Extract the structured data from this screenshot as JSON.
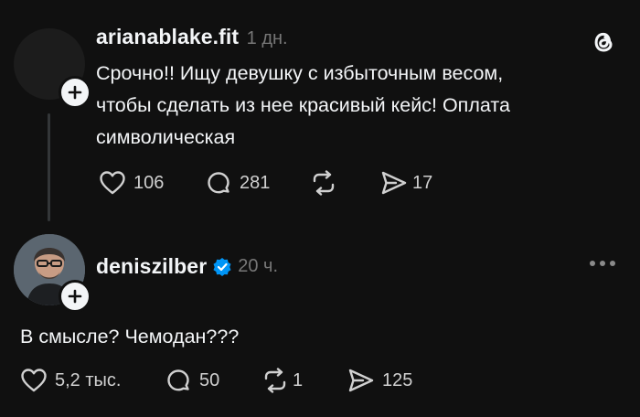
{
  "post1": {
    "username": "arianablake.fit",
    "time": "1 дн.",
    "lines": [
      "Срочно!! Ищу девушку с избыточным весом,",
      "чтобы сделать из нее красивый кейс! Оплата",
      "символическая"
    ],
    "likes": "106",
    "replies": "281",
    "reposts": "",
    "shares": "17"
  },
  "post2": {
    "username": "deniszilber",
    "time": "20 ч.",
    "text": "В смысле? Чемодан???",
    "likes": "5,2 тыс.",
    "replies": "50",
    "reposts": "1",
    "shares": "125"
  },
  "colors": {
    "background": "#101010",
    "text": "#f3f5f7",
    "muted": "#777777",
    "verified": "#0095f6"
  },
  "icons": {
    "app_logo": "threads-logo-icon",
    "like": "heart-icon",
    "reply": "speech-bubble-icon",
    "repost": "repost-icon",
    "share": "send-icon",
    "follow": "plus-icon",
    "verified": "verified-badge-icon",
    "more": "more-dots-icon"
  }
}
